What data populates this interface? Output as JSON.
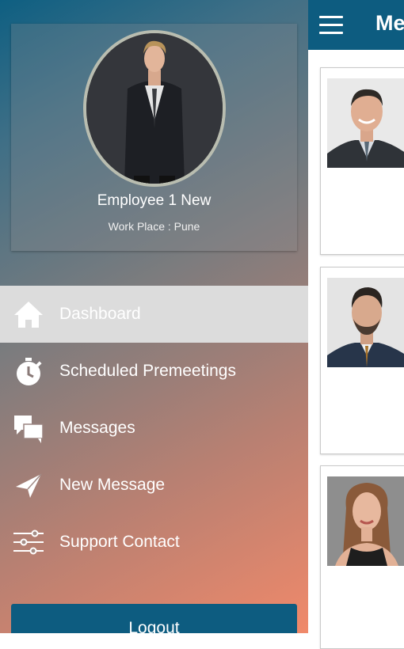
{
  "appbar": {
    "title": "Me",
    "menu_icon": "hamburger-icon"
  },
  "cards": [
    {
      "photo": "man-in-suit-photo"
    },
    {
      "photo": "bearded-man-photo"
    },
    {
      "photo": "woman-photo"
    }
  ],
  "drawer": {
    "profile": {
      "name": "Employee 1 New",
      "workplace": "Work Place : Pune"
    },
    "menu": [
      {
        "label": "Dashboard",
        "icon": "home-icon",
        "active": true
      },
      {
        "label": "Scheduled Premeetings",
        "icon": "stopwatch-icon",
        "active": false
      },
      {
        "label": "Messages",
        "icon": "chat-bubbles-icon",
        "active": false
      },
      {
        "label": "New Message",
        "icon": "send-icon",
        "active": false
      },
      {
        "label": "Support Contact",
        "icon": "sliders-icon",
        "active": false
      }
    ],
    "logout_label": "Logout"
  },
  "colors": {
    "primary": "#0d5c80",
    "drawer_gradient_start": "#0e5f82",
    "drawer_gradient_end": "#f0896a",
    "active_item_bg": "#dcdcdc"
  }
}
